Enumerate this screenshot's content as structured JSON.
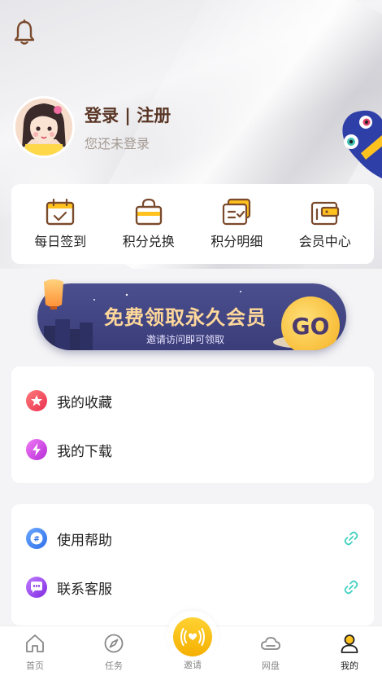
{
  "header": {
    "login_title": "登录 | 注册",
    "login_subtitle": "您还未登录"
  },
  "quick_actions": [
    {
      "label": "每日签到",
      "icon": "calendar-check-icon"
    },
    {
      "label": "积分兑换",
      "icon": "shopping-bag-icon"
    },
    {
      "label": "积分明细",
      "icon": "points-detail-icon"
    },
    {
      "label": "会员中心",
      "icon": "member-wallet-icon"
    }
  ],
  "banner": {
    "title": "免费领取永久会员",
    "subtitle": "邀请访问即可领取",
    "go_label": "GO"
  },
  "list_card_1": [
    {
      "label": "我的收藏",
      "icon": "star-icon",
      "color": "#f2475f"
    },
    {
      "label": "我的下载",
      "icon": "lightning-icon",
      "color": "#d23fe0"
    }
  ],
  "list_card_2": [
    {
      "label": "使用帮助",
      "icon": "help-hash-icon",
      "color": "#3d7ef0"
    },
    {
      "label": "联系客服",
      "icon": "chat-icon",
      "color": "#9b3ff0"
    }
  ],
  "tabbar": {
    "items": [
      {
        "label": "首页",
        "icon": "home-icon"
      },
      {
        "label": "任务",
        "icon": "compass-icon"
      },
      {
        "label": "邀请",
        "icon": "broadcast-icon"
      },
      {
        "label": "网盘",
        "icon": "cloud-icon"
      },
      {
        "label": "我的",
        "icon": "person-icon"
      }
    ],
    "active_index": 4
  },
  "colors": {
    "brand_brown": "#5a3626",
    "icon_brown": "#7a4a2c",
    "link_teal": "#3fd0c0",
    "invite_yellow": "#f5b000"
  }
}
